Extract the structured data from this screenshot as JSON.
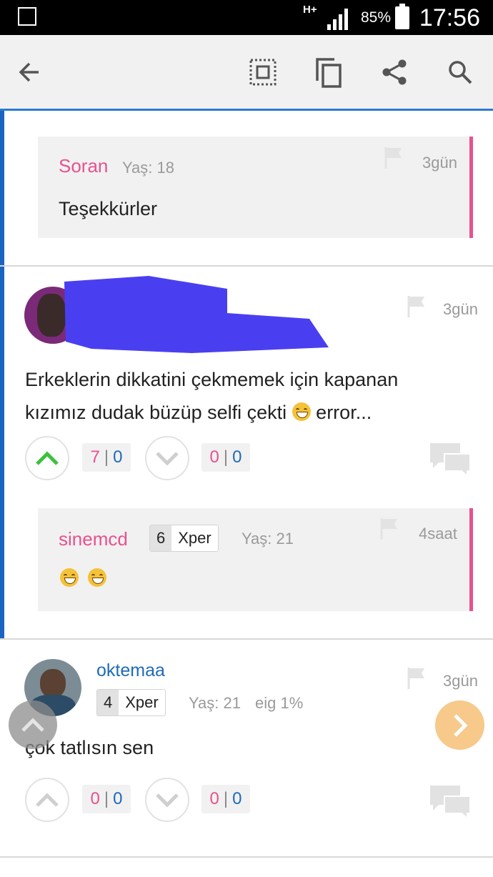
{
  "status_bar": {
    "network": "H+",
    "battery_pct": "85%",
    "time": "17:56"
  },
  "toolbar": {
    "icons": [
      "back-arrow-icon",
      "select-all-icon",
      "copy-icon",
      "share-icon",
      "search-icon"
    ]
  },
  "reply1": {
    "author": "Soran",
    "age": "Yaş: 18",
    "time": "3gün",
    "text": "Teşekkürler"
  },
  "post1": {
    "time": "3gün",
    "text_line1": "Erkeklerin dikkatini çekmemek için kapanan",
    "text_line2_before": "kızımız dudak büzüp selfi çekti ",
    "text_line2_after": " error...",
    "up_a": "7",
    "up_b": "0",
    "down_a": "0",
    "down_b": "0",
    "reply": {
      "author": "sinemcd",
      "level": "6",
      "level_label": "Xper",
      "age": "Yaş: 21",
      "time": "4saat"
    }
  },
  "post2": {
    "author": "oktemaa",
    "level": "4",
    "level_label": "Xper",
    "age": "Yaş: 21",
    "eig": "eig 1%",
    "time": "3gün",
    "text": "çok tatlısın sen",
    "up_a": "0",
    "up_b": "0",
    "down_a": "0",
    "down_b": "0"
  },
  "colors": {
    "accent_pink": "#e8518f",
    "accent_blue": "#1e6bb8",
    "toolbar_line": "#2a7bd4",
    "upvote_green": "#3cc13c",
    "next_fab": "#f7c98b"
  }
}
